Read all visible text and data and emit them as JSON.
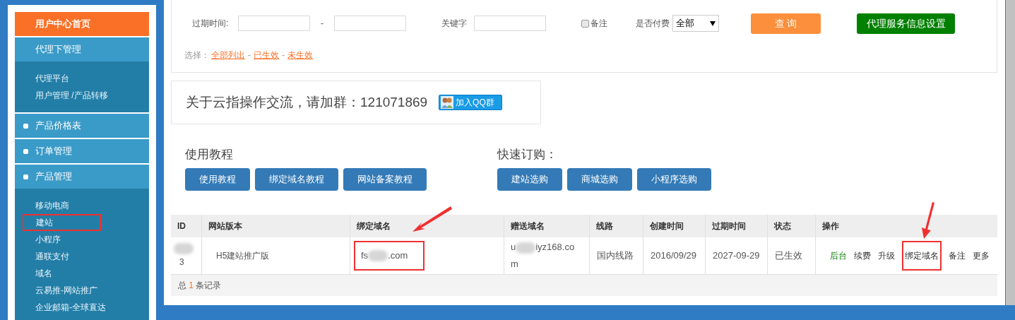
{
  "sidebar": {
    "home": "用户中心首页",
    "groups": [
      {
        "label": "代理下管理",
        "bullet": false,
        "children": [
          {
            "label": "代理平台",
            "selected": false
          },
          {
            "label": "用户管理 /产品转移",
            "selected": false
          }
        ]
      },
      {
        "label": "产品价格表",
        "bullet": true
      },
      {
        "label": "订单管理",
        "bullet": true
      },
      {
        "label": "产品管理",
        "bullet": true,
        "children": [
          {
            "label": "移动电商",
            "selected": false
          },
          {
            "label": "建站",
            "selected": true
          },
          {
            "label": "小程序",
            "selected": false
          },
          {
            "label": "通联支付",
            "selected": false
          },
          {
            "label": "域名",
            "selected": false
          },
          {
            "label": "云易推-网站推广",
            "selected": false
          },
          {
            "label": "企业邮箱-全球直达",
            "selected": false
          }
        ]
      }
    ]
  },
  "filter": {
    "expire_label": "过期时间:",
    "range_sep": "-",
    "keyword_label": "关键字",
    "note": {
      "label": "备注",
      "checked": false
    },
    "paid_label": "是否付费",
    "paid_value": "全部",
    "search_button": "查 询",
    "settings_button": "代理服务信息设置",
    "choose_label": "选择：",
    "links": [
      "全部列出",
      "已生效",
      "未生效"
    ],
    "link_sep": "-"
  },
  "qq": {
    "text": "关于云指操作交流，请加群：121071869",
    "button": "加入QQ群"
  },
  "tutorials": {
    "title": "使用教程",
    "buttons": [
      "使用教程",
      "绑定域名教程",
      "网站备案教程"
    ]
  },
  "quick_order": {
    "title": "快速订购：",
    "buttons": [
      "建站选购",
      "商城选购",
      "小程序选购"
    ]
  },
  "table": {
    "columns": [
      "ID",
      "网站版本",
      "绑定域名",
      "赠送域名",
      "线路",
      "创建时间",
      "过期时间",
      "状态",
      "操作"
    ],
    "rows": [
      {
        "id": "3",
        "version": "H5建站推广版",
        "domain_start": "fs",
        "domain_end": ".com",
        "gift_start": "u",
        "gift_end": "iyz168.com",
        "line": "国内线路",
        "created": "2016/09/29",
        "expires": "2027-09-29",
        "status": "已生效",
        "actions": [
          {
            "label": "后台",
            "kind": "primary"
          },
          {
            "label": "续费",
            "kind": "normal"
          },
          {
            "label": "升级",
            "kind": "normal"
          },
          {
            "label": "绑定域名",
            "kind": "normal"
          },
          {
            "label": "备注",
            "kind": "normal"
          },
          {
            "label": "更多",
            "kind": "normal"
          }
        ]
      }
    ],
    "footer": {
      "prefix": "总",
      "count": "1",
      "suffix": "条记录"
    }
  }
}
